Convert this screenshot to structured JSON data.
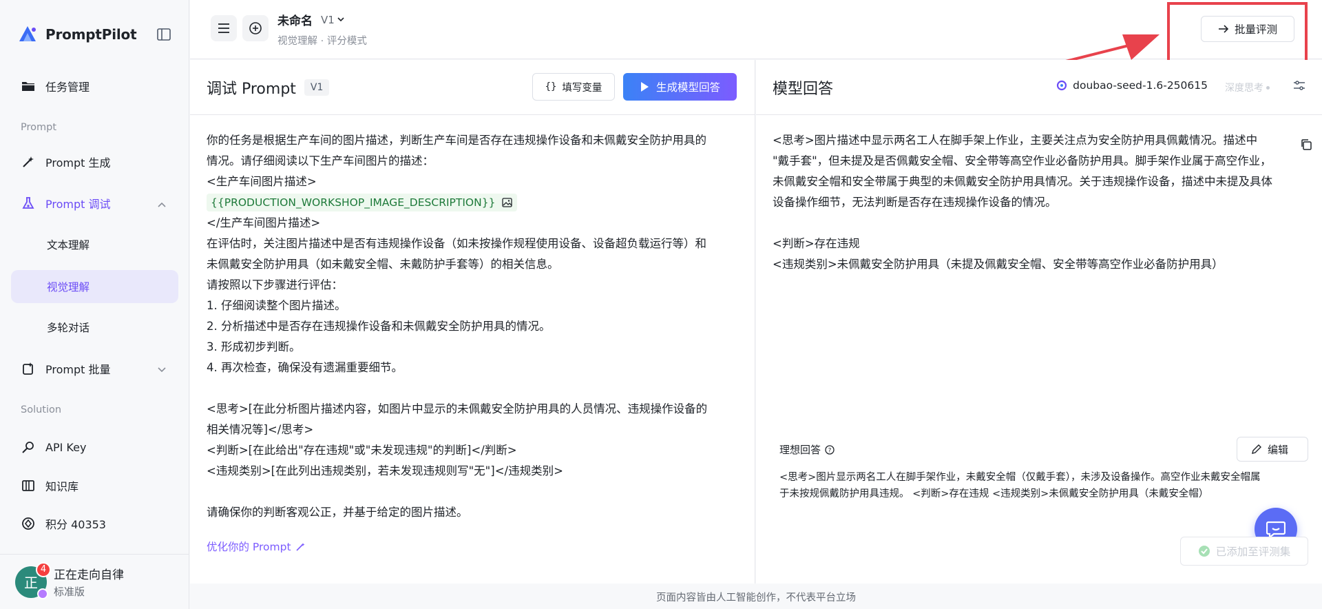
{
  "app": {
    "name": "PromptPilot"
  },
  "sidebar": {
    "task_mgmt": "任务管理",
    "section_prompt": "Prompt",
    "prompt_gen": "Prompt 生成",
    "prompt_debug": "Prompt 调试",
    "sub_text": "文本理解",
    "sub_visual": "视觉理解",
    "sub_multi": "多轮对话",
    "prompt_batch": "Prompt 批量",
    "section_solution": "Solution",
    "api_key": "API Key",
    "kb": "知识库",
    "points": "积分 40353"
  },
  "user": {
    "avatar_char": "正",
    "badge": "4",
    "name": "正在走向自律",
    "plan": "标准版"
  },
  "header": {
    "title": "未命名",
    "version": "V1",
    "subtitle": "视觉理解 · 评分模式",
    "batch_eval": "批量评测"
  },
  "left_panel": {
    "title": "调试 Prompt",
    "version_tag": "V1",
    "fill_vars": "填写变量",
    "gen_answer": "生成模型回答",
    "lines": [
      "你的任务是根据生产车间的图片描述，判断生产车间是否存在违规操作设备和未佩戴安全防护用具的",
      "情况。请仔细阅读以下生产车间图片的描述：",
      "<生产车间图片描述>",
      "",
      "</生产车间图片描述>",
      "在评估时，关注图片描述中是否有违规操作设备（如未按操作规程使用设备、设备超负载运行等）和",
      "未佩戴安全防护用具（如未戴安全帽、未戴防护手套等）的相关信息。",
      "请按照以下步骤进行评估：",
      "1. 仔细阅读整个图片描述。",
      "2. 分析描述中是否存在违规操作设备和未佩戴安全防护用具的情况。",
      "3. 形成初步判断。",
      "4. 再次检查，确保没有遗漏重要细节。",
      "",
      "<思考>[在此分析图片描述内容，如图片中显示的未佩戴安全防护用具的人员情况、违规操作设备的",
      "相关情况等]</思考>",
      "<判断>[在此给出\"存在违规\"或\"未发现违规\"的判断]</判断>",
      "<违规类别>[在此列出违规类别，若未发现违规则写\"无\"]</违规类别>",
      "",
      "请确保你的判断客观公正，并基于给定的图片描述。"
    ],
    "variable": "{{PRODUCTION_WORKSHOP_IMAGE_DESCRIPTION}}",
    "optimize": "优化你的 Prompt"
  },
  "right_panel": {
    "title": "模型回答",
    "model": "doubao-seed-1.6-250615",
    "deep_think": "深度思考",
    "lines": [
      "<思考>图片描述中显示两名工人在脚手架上作业，主要关注点为安全防护用具佩戴情况。描述中",
      "\"戴手套\"，但未提及是否佩戴安全帽、安全带等高空作业必备防护用具。脚手架作业属于高空作业，",
      "未佩戴安全帽和安全带属于典型的未佩戴安全防护用具情况。关于违规操作设备，描述中未提及具体",
      "设备操作细节，无法判断是否存在违规操作设备的情况。",
      "",
      "<判断>存在违规",
      "<违规类别>未佩戴安全防护用具（未提及佩戴安全帽、安全带等高空作业必备防护用具）"
    ],
    "ideal_label": "理想回答",
    "edit": "编辑",
    "ideal_text": "<思考>图片显示两名工人在脚手架作业，未戴安全帽（仅戴手套），未涉及设备操作。高空作业未戴安全帽属于未按规佩戴防护用具违规。 <判断>存在违规 <违规类别>未佩戴安全防护用具（未戴安全帽）",
    "added": "已添加至评测集"
  },
  "footer": {
    "note": "页面内容皆由人工智能创作，不代表平台立场"
  },
  "colors": {
    "accent": "#6b4cf6",
    "annotation_red": "#e8424c",
    "variable_green": "#1e7a3a"
  }
}
